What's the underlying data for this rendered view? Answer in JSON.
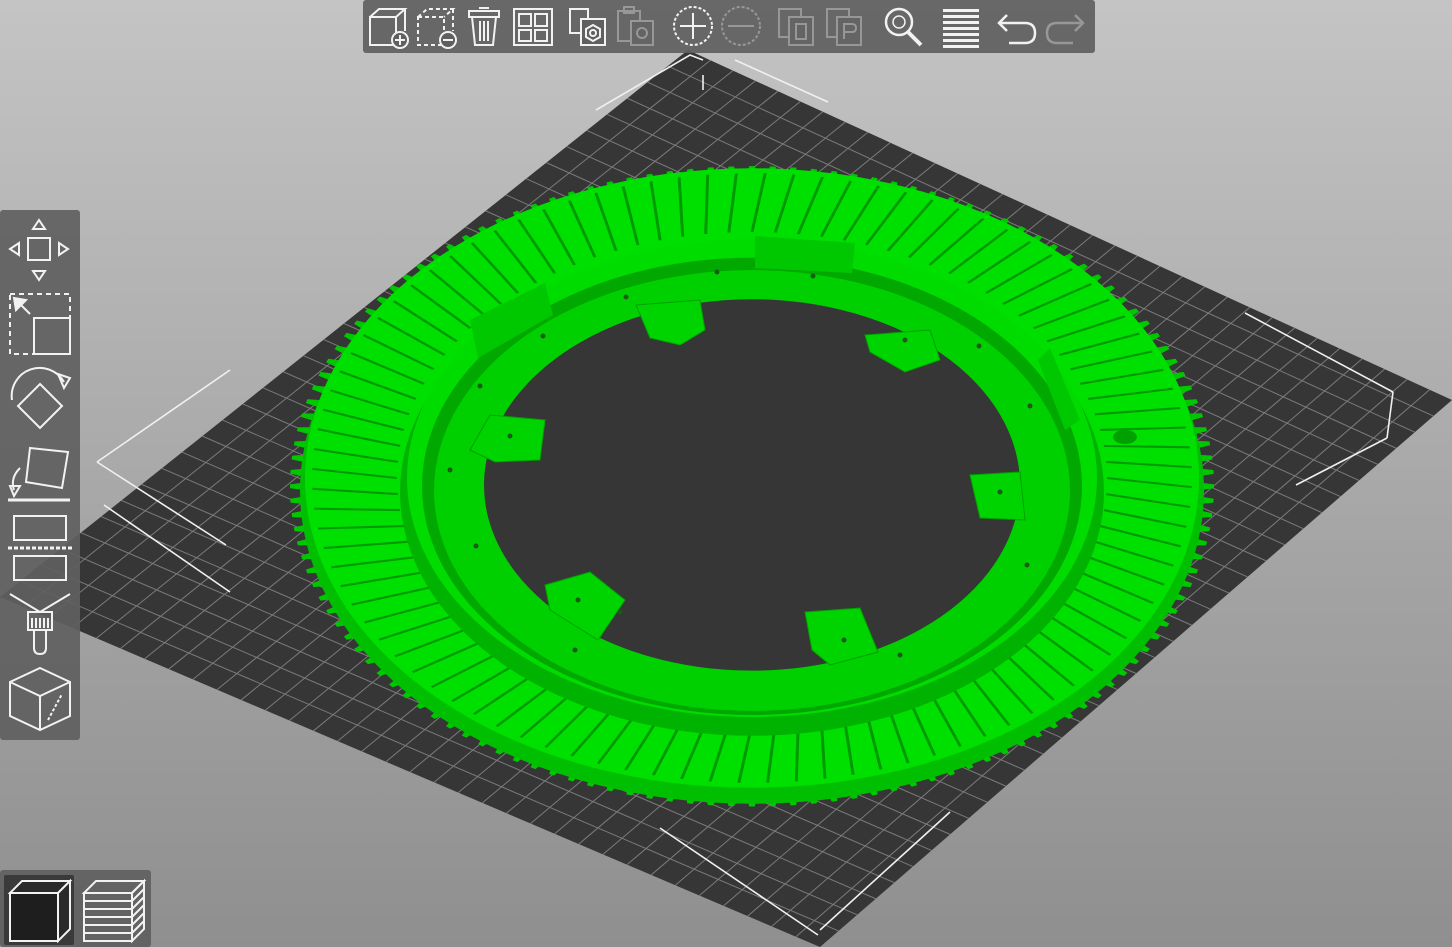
{
  "app": {
    "mode": "3d-editor"
  },
  "colors": {
    "background_top": "#c4c4c4",
    "background_bottom": "#8f8f8f",
    "bed": "#363636",
    "bed_grid": "#7b7b7b",
    "model": "#00e600",
    "model_shade": "#00b400",
    "toolbar": "#5f5f5f",
    "icon": "#f2f2f2"
  },
  "top_toolbar": {
    "buttons": [
      {
        "icon": "add-object-icon",
        "enabled": true
      },
      {
        "icon": "delete-object-icon",
        "enabled": true
      },
      {
        "icon": "delete-all-icon",
        "enabled": true
      },
      {
        "icon": "arrange-icon",
        "enabled": true
      },
      {
        "icon": "copy-icon",
        "enabled": true
      },
      {
        "icon": "paste-icon",
        "enabled": false
      },
      {
        "icon": "add-instance-icon",
        "enabled": true
      },
      {
        "icon": "remove-instance-icon",
        "enabled": false
      },
      {
        "icon": "split-to-objects-icon",
        "enabled": false
      },
      {
        "icon": "split-to-parts-icon",
        "enabled": false
      },
      {
        "icon": "search-icon",
        "enabled": true
      },
      {
        "icon": "layers-editing-icon",
        "enabled": true
      },
      {
        "icon": "undo-icon",
        "enabled": true
      },
      {
        "icon": "redo-icon",
        "enabled": false
      }
    ]
  },
  "left_toolbar": {
    "tools": [
      {
        "icon": "move-icon"
      },
      {
        "icon": "scale-icon"
      },
      {
        "icon": "rotate-icon"
      },
      {
        "icon": "place-on-face-icon"
      },
      {
        "icon": "cut-icon"
      },
      {
        "icon": "paint-supports-icon"
      },
      {
        "icon": "seam-painting-icon"
      }
    ]
  },
  "view_toolbar": {
    "buttons": [
      {
        "icon": "3d-view-icon",
        "active": true
      },
      {
        "icon": "preview-layers-icon",
        "active": false
      }
    ]
  }
}
